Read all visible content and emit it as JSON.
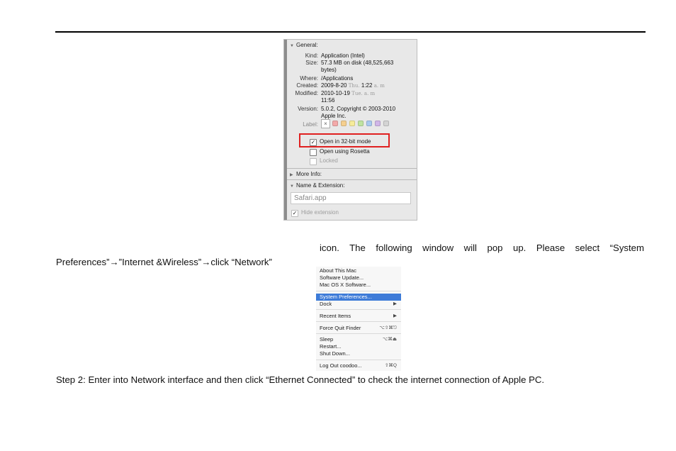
{
  "info_panel": {
    "general_header": "General:",
    "rows": [
      {
        "key": "Kind:",
        "value": "Application (Intel)"
      },
      {
        "key": "Size:",
        "value": "57.3 MB on disk (48,525,663"
      },
      {
        "key": "",
        "value": "bytes)"
      },
      {
        "key": "Where:",
        "value": "/Applications"
      },
      {
        "key": "Created:",
        "value": "2009-8-20",
        "value_gray": "Thu.",
        "value_tail": "1:22",
        "value_gray2": "a. m"
      },
      {
        "key": "Modified:",
        "value": "2010-10-19",
        "value_gray": "Tue. a. m",
        "value_tail": "",
        "value_gray2": ""
      },
      {
        "key": "",
        "value": "11:56"
      },
      {
        "key": "Version:",
        "value": "5.0.2, Copyright © 2003-2010"
      },
      {
        "key": "",
        "value": "Apple Inc."
      }
    ],
    "label_key": "Label:",
    "label_x": "×",
    "label_colors": [
      "#f3a9a9",
      "#f5cf8f",
      "#f6ec9a",
      "#bfe3a1",
      "#a9c9f0",
      "#d0b6e8",
      "#d4d4d4"
    ],
    "checkboxes": [
      {
        "label": "Open in 32-bit mode",
        "checked": "✓"
      },
      {
        "label": "Open using Rosetta",
        "checked": ""
      },
      {
        "label": "Locked",
        "checked": ""
      }
    ],
    "more_info_header": "More Info:",
    "name_ext_header": "Name & Extension:",
    "name_value": "Safari.app",
    "hide_extension": {
      "label": "Hide extension",
      "checked": "✓"
    },
    "accent_highlight": "#e02020"
  },
  "text": {
    "line1": "icon. The following window will pop up. Please select “System",
    "line2": "Preferences”→”Internet &Wireless”→click “Network”",
    "step2": "Step 2: Enter into Network interface and then click “Ethernet Connected” to check the internet connection of Apple PC."
  },
  "apple_menu": {
    "items": [
      {
        "label": "About This Mac",
        "shortcut": ""
      },
      {
        "label": "Software Update...",
        "shortcut": ""
      },
      {
        "label": "Mac OS X Software...",
        "shortcut": ""
      },
      {
        "label": "System Preferences...",
        "shortcut": "",
        "selected": true
      },
      {
        "label": "Dock",
        "shortcut": "▶"
      },
      {
        "label": "Recent Items",
        "shortcut": "▶"
      },
      {
        "label": "Force Quit Finder",
        "shortcut": "⌥⇧⌘⎋"
      },
      {
        "label": "Sleep",
        "shortcut": "⌥⌘⏏"
      },
      {
        "label": "Restart...",
        "shortcut": ""
      },
      {
        "label": "Shut Down...",
        "shortcut": ""
      },
      {
        "label": "Log Out coodoo...",
        "shortcut": "⇧⌘Q"
      }
    ],
    "selected_color": "#3d7bd8"
  }
}
